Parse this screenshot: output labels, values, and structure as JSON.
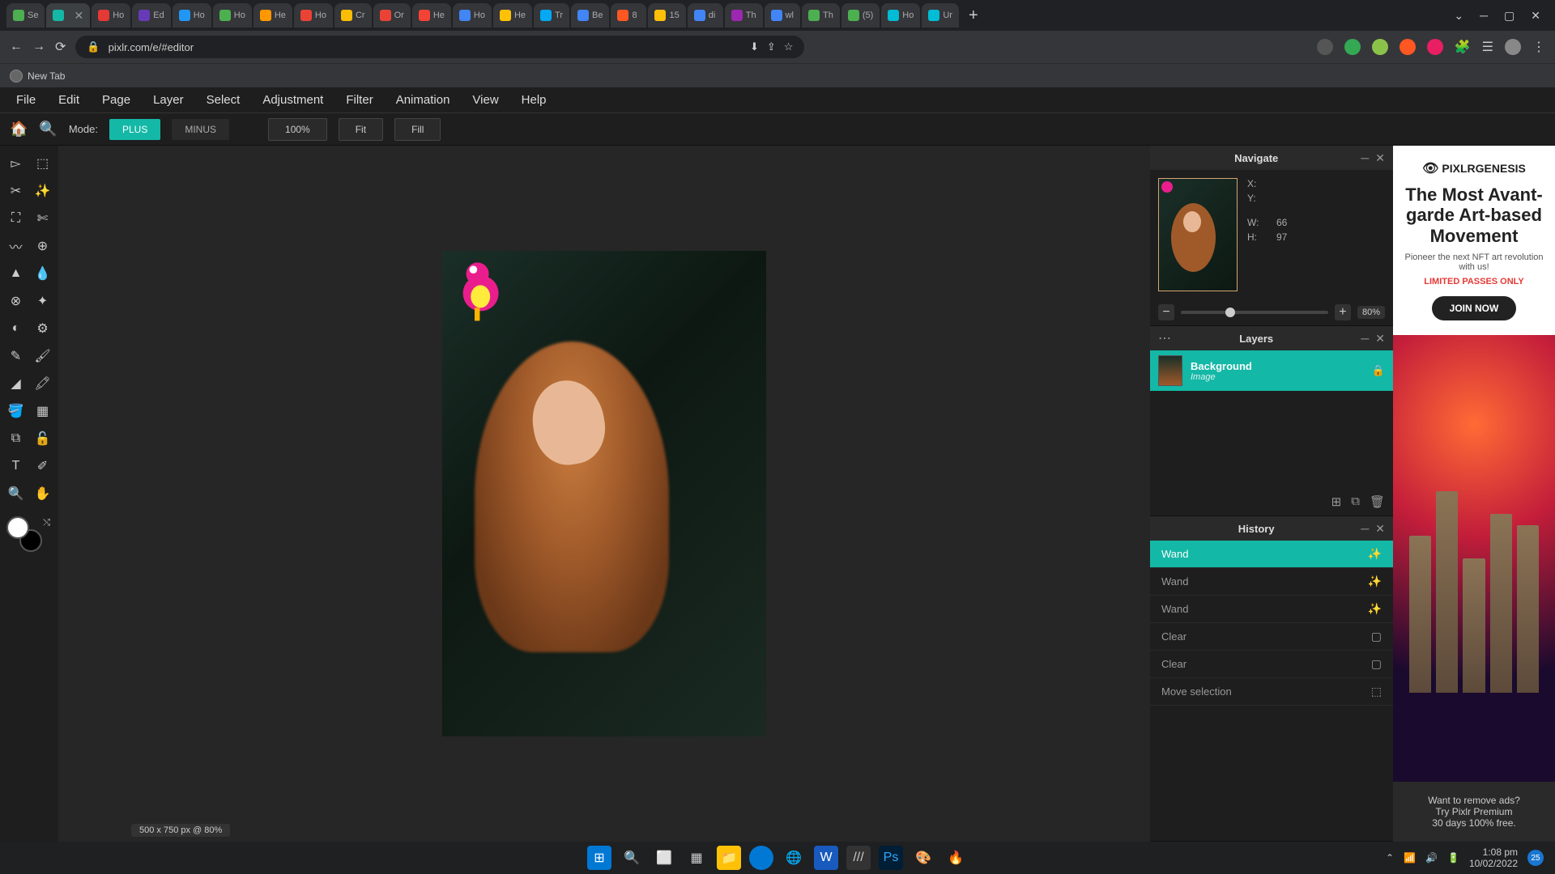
{
  "browser": {
    "tabs": [
      {
        "label": "Se",
        "color": "#4caf50"
      },
      {
        "label": "",
        "color": "#14b8a6",
        "active": true
      },
      {
        "label": "Ho",
        "color": "#e53935"
      },
      {
        "label": "Ed",
        "color": "#673ab7"
      },
      {
        "label": "Ho",
        "color": "#2196f3"
      },
      {
        "label": "Ho",
        "color": "#4caf50"
      },
      {
        "label": "He",
        "color": "#ff9800"
      },
      {
        "label": "Ho",
        "color": "#ea4335"
      },
      {
        "label": "Cr",
        "color": "#fbbc04"
      },
      {
        "label": "Or",
        "color": "#ea4335"
      },
      {
        "label": "He",
        "color": "#f44336"
      },
      {
        "label": "Ho",
        "color": "#4285f4"
      },
      {
        "label": "He",
        "color": "#ffc107"
      },
      {
        "label": "Tr",
        "color": "#03a9f4"
      },
      {
        "label": "Be",
        "color": "#4285f4"
      },
      {
        "label": "8",
        "color": "#ff5722"
      },
      {
        "label": "15",
        "color": "#ffc107"
      },
      {
        "label": "di",
        "color": "#4285f4"
      },
      {
        "label": "Th",
        "color": "#9c27b0"
      },
      {
        "label": "wl",
        "color": "#4285f4"
      },
      {
        "label": "Th",
        "color": "#4caf50"
      },
      {
        "label": "(5)",
        "color": "#4caf50"
      },
      {
        "label": "Ho",
        "color": "#00bcd4"
      },
      {
        "label": "Ur",
        "color": "#00bcd4"
      }
    ],
    "url": "pixlr.com/e/#editor",
    "bookmarks": [
      {
        "label": "New Tab"
      }
    ]
  },
  "menubar": [
    "File",
    "Edit",
    "Page",
    "Layer",
    "Select",
    "Adjustment",
    "Filter",
    "Animation",
    "View",
    "Help"
  ],
  "optionsbar": {
    "mode_label": "Mode:",
    "plus": "PLUS",
    "minus": "MINUS",
    "hundred": "100%",
    "fit": "Fit",
    "fill": "Fill"
  },
  "canvas": {
    "info": "500 x 750 px @ 80%"
  },
  "navigate": {
    "title": "Navigate",
    "x_label": "X:",
    "y_label": "Y:",
    "w_label": "W:",
    "h_label": "H:",
    "w_val": "66",
    "h_val": "97",
    "zoom": "80%"
  },
  "layers": {
    "title": "Layers",
    "items": [
      {
        "name": "Background",
        "type": "Image"
      }
    ]
  },
  "history": {
    "title": "History",
    "items": [
      {
        "label": "Wand",
        "icon": "wand",
        "active": true
      },
      {
        "label": "Wand",
        "icon": "wand"
      },
      {
        "label": "Wand",
        "icon": "wand"
      },
      {
        "label": "Clear",
        "icon": "clear"
      },
      {
        "label": "Clear",
        "icon": "clear"
      },
      {
        "label": "Move selection",
        "icon": "select"
      }
    ]
  },
  "ad": {
    "logo": "PIXLRGENESIS",
    "headline": "The Most Avant-garde Art-based Movement",
    "sub": "Pioneer the next NFT art revolution with us!",
    "limited": "LIMITED PASSES ONLY",
    "cta": "JOIN NOW",
    "footer1": "Want to remove ads?",
    "footer2": "Try Pixlr Premium",
    "footer3": "30 days 100% free."
  },
  "taskbar": {
    "time": "1:08 pm",
    "date": "10/02/2022",
    "notif": "25"
  }
}
